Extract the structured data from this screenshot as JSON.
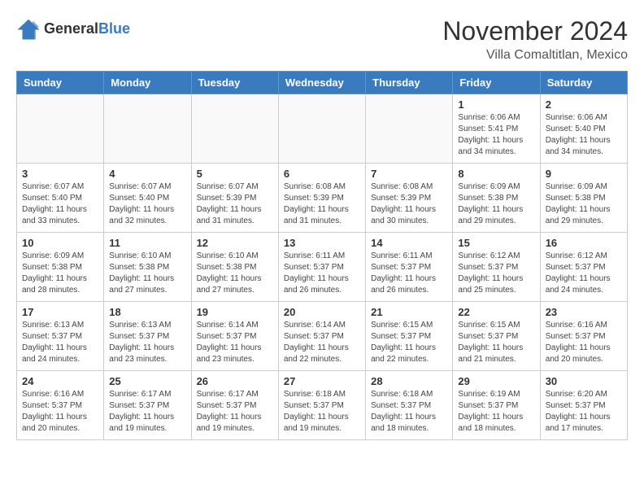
{
  "header": {
    "logo": {
      "general": "General",
      "blue": "Blue"
    },
    "title": "November 2024",
    "location": "Villa Comaltitlan, Mexico"
  },
  "weekdays": [
    "Sunday",
    "Monday",
    "Tuesday",
    "Wednesday",
    "Thursday",
    "Friday",
    "Saturday"
  ],
  "weeks": [
    [
      {
        "day": "",
        "info": ""
      },
      {
        "day": "",
        "info": ""
      },
      {
        "day": "",
        "info": ""
      },
      {
        "day": "",
        "info": ""
      },
      {
        "day": "",
        "info": ""
      },
      {
        "day": "1",
        "info": "Sunrise: 6:06 AM\nSunset: 5:41 PM\nDaylight: 11 hours and 34 minutes."
      },
      {
        "day": "2",
        "info": "Sunrise: 6:06 AM\nSunset: 5:40 PM\nDaylight: 11 hours and 34 minutes."
      }
    ],
    [
      {
        "day": "3",
        "info": "Sunrise: 6:07 AM\nSunset: 5:40 PM\nDaylight: 11 hours and 33 minutes."
      },
      {
        "day": "4",
        "info": "Sunrise: 6:07 AM\nSunset: 5:40 PM\nDaylight: 11 hours and 32 minutes."
      },
      {
        "day": "5",
        "info": "Sunrise: 6:07 AM\nSunset: 5:39 PM\nDaylight: 11 hours and 31 minutes."
      },
      {
        "day": "6",
        "info": "Sunrise: 6:08 AM\nSunset: 5:39 PM\nDaylight: 11 hours and 31 minutes."
      },
      {
        "day": "7",
        "info": "Sunrise: 6:08 AM\nSunset: 5:39 PM\nDaylight: 11 hours and 30 minutes."
      },
      {
        "day": "8",
        "info": "Sunrise: 6:09 AM\nSunset: 5:38 PM\nDaylight: 11 hours and 29 minutes."
      },
      {
        "day": "9",
        "info": "Sunrise: 6:09 AM\nSunset: 5:38 PM\nDaylight: 11 hours and 29 minutes."
      }
    ],
    [
      {
        "day": "10",
        "info": "Sunrise: 6:09 AM\nSunset: 5:38 PM\nDaylight: 11 hours and 28 minutes."
      },
      {
        "day": "11",
        "info": "Sunrise: 6:10 AM\nSunset: 5:38 PM\nDaylight: 11 hours and 27 minutes."
      },
      {
        "day": "12",
        "info": "Sunrise: 6:10 AM\nSunset: 5:38 PM\nDaylight: 11 hours and 27 minutes."
      },
      {
        "day": "13",
        "info": "Sunrise: 6:11 AM\nSunset: 5:37 PM\nDaylight: 11 hours and 26 minutes."
      },
      {
        "day": "14",
        "info": "Sunrise: 6:11 AM\nSunset: 5:37 PM\nDaylight: 11 hours and 26 minutes."
      },
      {
        "day": "15",
        "info": "Sunrise: 6:12 AM\nSunset: 5:37 PM\nDaylight: 11 hours and 25 minutes."
      },
      {
        "day": "16",
        "info": "Sunrise: 6:12 AM\nSunset: 5:37 PM\nDaylight: 11 hours and 24 minutes."
      }
    ],
    [
      {
        "day": "17",
        "info": "Sunrise: 6:13 AM\nSunset: 5:37 PM\nDaylight: 11 hours and 24 minutes."
      },
      {
        "day": "18",
        "info": "Sunrise: 6:13 AM\nSunset: 5:37 PM\nDaylight: 11 hours and 23 minutes."
      },
      {
        "day": "19",
        "info": "Sunrise: 6:14 AM\nSunset: 5:37 PM\nDaylight: 11 hours and 23 minutes."
      },
      {
        "day": "20",
        "info": "Sunrise: 6:14 AM\nSunset: 5:37 PM\nDaylight: 11 hours and 22 minutes."
      },
      {
        "day": "21",
        "info": "Sunrise: 6:15 AM\nSunset: 5:37 PM\nDaylight: 11 hours and 22 minutes."
      },
      {
        "day": "22",
        "info": "Sunrise: 6:15 AM\nSunset: 5:37 PM\nDaylight: 11 hours and 21 minutes."
      },
      {
        "day": "23",
        "info": "Sunrise: 6:16 AM\nSunset: 5:37 PM\nDaylight: 11 hours and 20 minutes."
      }
    ],
    [
      {
        "day": "24",
        "info": "Sunrise: 6:16 AM\nSunset: 5:37 PM\nDaylight: 11 hours and 20 minutes."
      },
      {
        "day": "25",
        "info": "Sunrise: 6:17 AM\nSunset: 5:37 PM\nDaylight: 11 hours and 19 minutes."
      },
      {
        "day": "26",
        "info": "Sunrise: 6:17 AM\nSunset: 5:37 PM\nDaylight: 11 hours and 19 minutes."
      },
      {
        "day": "27",
        "info": "Sunrise: 6:18 AM\nSunset: 5:37 PM\nDaylight: 11 hours and 19 minutes."
      },
      {
        "day": "28",
        "info": "Sunrise: 6:18 AM\nSunset: 5:37 PM\nDaylight: 11 hours and 18 minutes."
      },
      {
        "day": "29",
        "info": "Sunrise: 6:19 AM\nSunset: 5:37 PM\nDaylight: 11 hours and 18 minutes."
      },
      {
        "day": "30",
        "info": "Sunrise: 6:20 AM\nSunset: 5:37 PM\nDaylight: 11 hours and 17 minutes."
      }
    ]
  ]
}
